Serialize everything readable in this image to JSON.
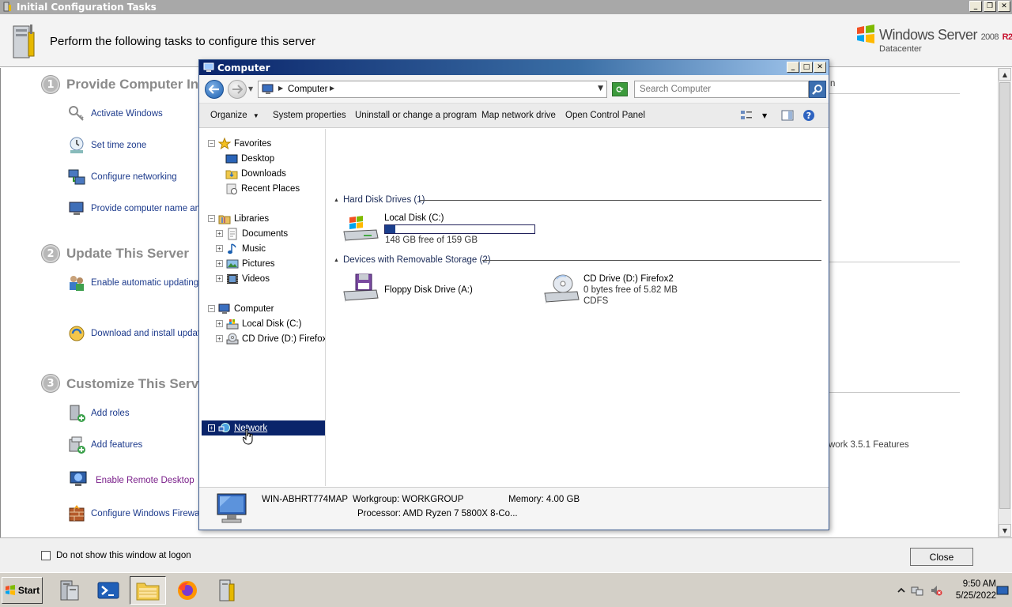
{
  "ict": {
    "title": "Initial Configuration Tasks",
    "header_text": "Perform the following tasks to configure this server",
    "logo": {
      "name": "Windows Server",
      "version": "2008",
      "release": "R2",
      "edition": "Datacenter"
    },
    "sections": [
      {
        "number": "1",
        "title": "Provide Computer In",
        "tasks": [
          "Activate Windows",
          "Set time zone",
          "Configure networking",
          "Provide computer name and"
        ]
      },
      {
        "number": "2",
        "title": "Update This Server",
        "tasks": [
          "Enable automatic updating a",
          "Download and install updates"
        ]
      },
      {
        "number": "3",
        "title": "Customize This Serve",
        "tasks": [
          "Add roles",
          "Add features",
          "Enable Remote Desktop",
          "Configure Windows Firewall"
        ]
      }
    ],
    "right_fragments": {
      "top": "n",
      "features": "work 3.5.1 Features"
    },
    "footer": {
      "checkbox_label": "Do not show this window at logon",
      "close_label": "Close"
    }
  },
  "explorer": {
    "title": "Computer",
    "address": "Computer",
    "search_placeholder": "Search Computer",
    "toolbar": {
      "organize": "Organize",
      "system_properties": "System properties",
      "uninstall": "Uninstall or change a program",
      "map_drive": "Map network drive",
      "control_panel": "Open Control Panel"
    },
    "nav": {
      "favorites": "Favorites",
      "desktop": "Desktop",
      "downloads": "Downloads",
      "recent": "Recent Places",
      "libraries": "Libraries",
      "documents": "Documents",
      "music": "Music",
      "pictures": "Pictures",
      "videos": "Videos",
      "computer": "Computer",
      "local_disk": "Local Disk (C:)",
      "cd_drive": "CD Drive (D:) Firefox2",
      "network": "Network"
    },
    "groups": {
      "hard_disks": "Hard Disk Drives (1)",
      "removable": "Devices with Removable Storage (2)"
    },
    "drives": {
      "c": {
        "name": "Local Disk (C:)",
        "free": "148 GB free of 159 GB",
        "used_fraction": 0.07
      },
      "a": {
        "name": "Floppy Disk Drive (A:)"
      },
      "d": {
        "name": "CD Drive (D:) Firefox2",
        "free": "0 bytes free of 5.82 MB",
        "fs": "CDFS"
      }
    },
    "details": {
      "computer_name": "WIN-ABHRT774MAP",
      "workgroup": "Workgroup: WORKGROUP",
      "memory": "Memory: 4.00 GB",
      "processor": "Processor: AMD Ryzen 7 5800X 8-Co..."
    }
  },
  "taskbar": {
    "start_label": "Start",
    "time": "9:50 AM",
    "date": "5/25/2022"
  }
}
